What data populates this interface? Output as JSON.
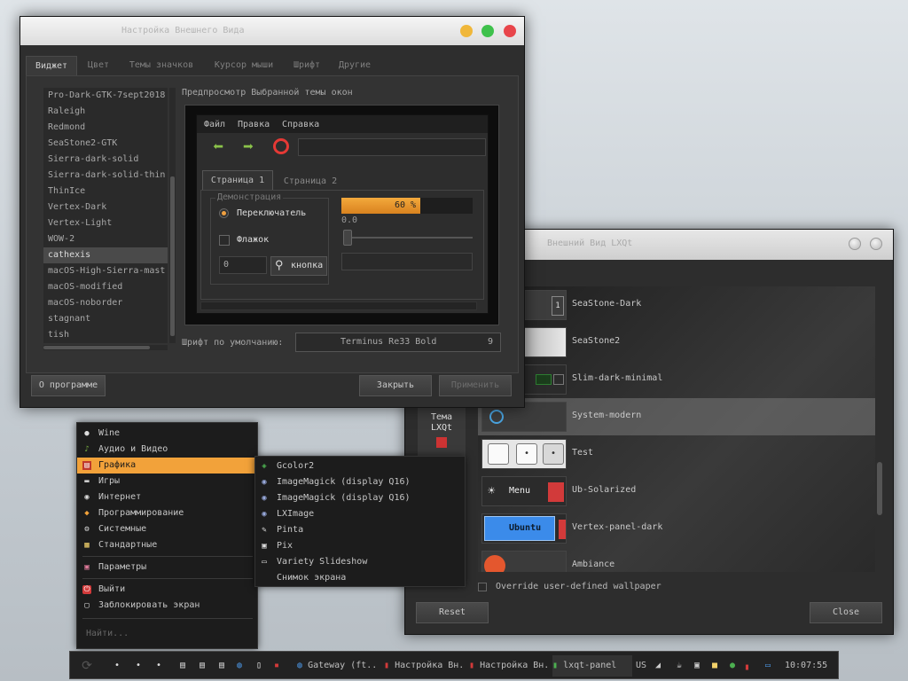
{
  "appearance_window": {
    "title": "Настройка Внешнего Вида",
    "tabs": [
      "Виджет",
      "Цвет",
      "Темы значков",
      "Курсор мыши",
      "Шрифт",
      "Другие"
    ],
    "active_tab": "Виджет",
    "widget_themes": [
      "Pro-Dark-GTK-7sept2018",
      "Raleigh",
      "Redmond",
      "SeaStone2-GTK",
      "Sierra-dark-solid",
      "Sierra-dark-solid-thin",
      "ThinIce",
      "Vertex-Dark",
      "Vertex-Light",
      "WOW-2",
      "cathexis",
      "macOS-High-Sierra-mast",
      "macOS-modified",
      "macOS-noborder",
      "stagnant",
      "tish"
    ],
    "selected_theme": "cathexis",
    "preview_label": "Предпросмотр Выбранной темы окон",
    "preview": {
      "menu": [
        "Файл",
        "Правка",
        "Справка"
      ],
      "tabs": [
        "Страница 1",
        "Страница 2"
      ],
      "group_label": "Демонстрация",
      "radio_label": "Переключатель",
      "checkbox_label": "Флажок",
      "spin_value": "0",
      "button_label": "кнопка",
      "progress_text": "60 %",
      "progress_value": 0.6,
      "slider_value": "0.0"
    },
    "default_font_label": "Шрифт по умолчанию:",
    "default_font_name": "Terminus Re33 Bold",
    "default_font_size": "9",
    "about_button": "О программе",
    "close_button": "Закрыть",
    "apply_button": "Применить",
    "colors": {
      "accent": "#f2a23a",
      "close": "#e8454a",
      "minimize": "#f0b73a",
      "maximize": "#3fc14b"
    }
  },
  "lxqt_theme_window": {
    "title": "Внешний Вид LXQt",
    "side_label_line1": "Тема",
    "side_label_line2": "LXQt",
    "themes": [
      "SeaStone-Dark",
      "SeaStone2",
      "Slim-dark-minimal",
      "System-modern",
      "Test",
      "Ub-Solarized",
      "Vertex-panel-dark",
      "Ambiance"
    ],
    "selected_theme": "System-modern",
    "thumb_menu_label": "Menu",
    "thumb_ubuntu_label": "Ubuntu",
    "override_wallpaper_label": "Override user-defined wallpaper",
    "reset_button": "Reset",
    "close_button": "Close"
  },
  "start_menu": {
    "items": [
      {
        "label": "Wine",
        "icon": "wine-icon"
      },
      {
        "label": "Аудио и Видео",
        "icon": "music-note-icon"
      },
      {
        "label": "Графика",
        "icon": "graphics-icon"
      },
      {
        "label": "Игры",
        "icon": "gamepad-icon"
      },
      {
        "label": "Интернет",
        "icon": "globe-icon"
      },
      {
        "label": "Программирование",
        "icon": "diamond-icon"
      },
      {
        "label": "Системные",
        "icon": "gear-icon"
      },
      {
        "label": "Стандартные",
        "icon": "notepad-icon"
      }
    ],
    "settings_label": "Параметры",
    "logout_label": "Выйти",
    "lock_label": "Заблокировать экран",
    "search_placeholder": "Найти...",
    "selected": "Графика"
  },
  "graphics_submenu": {
    "items": [
      {
        "label": "Gcolor2",
        "icon": "color-cube-icon"
      },
      {
        "label": "ImageMagick (display Q16)",
        "icon": "eye-icon"
      },
      {
        "label": "ImageMagick (display Q16)",
        "icon": "eye-icon"
      },
      {
        "label": "LXImage",
        "icon": "eye-icon"
      },
      {
        "label": "Pinta",
        "icon": "paint-icon"
      },
      {
        "label": "Pix",
        "icon": "camera-icon"
      },
      {
        "label": "Variety Slideshow",
        "icon": "monitor-icon"
      },
      {
        "label": "Снимок экрана",
        "icon": ""
      }
    ]
  },
  "taskbar": {
    "tasks": [
      "Gateway (ft...",
      "Настройка Вн...",
      "Настройка Вн...",
      "lxqt-panel"
    ],
    "keyboard_layout": "US",
    "clock": "10:07:55"
  }
}
